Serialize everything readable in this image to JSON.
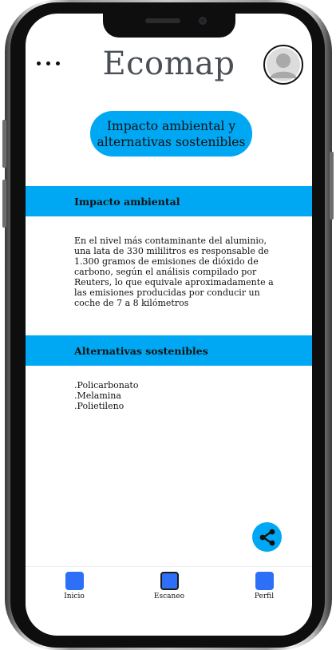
{
  "app": {
    "title": "Ecomap"
  },
  "header": {
    "menu_icon": "more-horizontal-icon",
    "profile_icon": "user-avatar-icon"
  },
  "page_title": "Impacto ambiental y alternativas sostenibles",
  "sections": {
    "impact": {
      "heading": "Impacto ambiental",
      "body": "En el nivel más contaminante del aluminio, una lata de 330 mililitros es responsable de 1.300 gramos de emisiones de dióxido de carbono, según el análisis compilado por Reuters, lo que equivale aproximadamente a las emisiones producidas por conducir un coche de 7 a 8 kilómetros"
    },
    "alternatives": {
      "heading": "Alternativas sostenibles",
      "items": [
        ".Policarbonato",
        ".Melamina",
        ".Polietileno"
      ]
    }
  },
  "share": {
    "icon": "share-icon"
  },
  "bottom_nav": {
    "items": [
      {
        "label": "Inicio",
        "icon": "home-icon"
      },
      {
        "label": "Escaneo",
        "icon": "scan-icon"
      },
      {
        "label": "Perfil",
        "icon": "profile-icon"
      }
    ],
    "active_index": 1
  },
  "colors": {
    "accent": "#00a8f3",
    "nav_icon": "#2d6ff7",
    "title_text": "#4a4f57"
  }
}
